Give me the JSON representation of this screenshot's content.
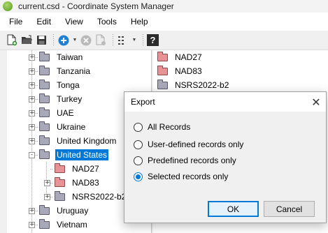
{
  "window": {
    "title": "current.csd - Coordinate System Manager"
  },
  "menu": {
    "items": [
      "File",
      "Edit",
      "View",
      "Tools",
      "Help"
    ]
  },
  "toolbar": {
    "icons": [
      "new-file-icon",
      "open-folder-icon",
      "save-icon",
      "add-icon",
      "delete-icon",
      "copy-record-icon",
      "view-options-icon",
      "help-icon"
    ],
    "help_label": "?"
  },
  "tree": {
    "items": [
      {
        "label": "Taiwan",
        "level": 0,
        "expander": "+"
      },
      {
        "label": "Tanzania",
        "level": 0,
        "expander": "+"
      },
      {
        "label": "Tonga",
        "level": 0,
        "expander": "+"
      },
      {
        "label": "Turkey",
        "level": 0,
        "expander": "+"
      },
      {
        "label": "UAE",
        "level": 0,
        "expander": "+"
      },
      {
        "label": "Ukraine",
        "level": 0,
        "expander": "+"
      },
      {
        "label": "United Kingdom",
        "level": 0,
        "expander": "+"
      },
      {
        "label": "United States",
        "level": 0,
        "expander": "-",
        "selected": true
      },
      {
        "label": "NAD27",
        "level": 1,
        "expander": "",
        "color": "red"
      },
      {
        "label": "NAD83",
        "level": 1,
        "expander": "+",
        "color": "red"
      },
      {
        "label": "NSRS2022-b2",
        "level": 1,
        "expander": "+"
      },
      {
        "label": "Uruguay",
        "level": 0,
        "expander": "+"
      },
      {
        "label": "Vietnam",
        "level": 0,
        "expander": "+"
      }
    ]
  },
  "list": {
    "items": [
      {
        "label": "NAD27",
        "color": "red"
      },
      {
        "label": "NAD83",
        "color": "red"
      },
      {
        "label": "NSRS2022-b2",
        "color": "gray"
      }
    ]
  },
  "dialog": {
    "title": "Export",
    "close_glyph": "✕",
    "options": [
      {
        "label": "All Records",
        "checked": false
      },
      {
        "label": "User-defined records only",
        "checked": false
      },
      {
        "label": "Predefined records only",
        "checked": false
      },
      {
        "label": "Selected records only",
        "checked": true
      }
    ],
    "ok_label": "OK",
    "cancel_label": "Cancel"
  },
  "colors": {
    "accent": "#0078d7",
    "folder_red": "#e79395",
    "folder_gray": "#a9a8b9"
  }
}
